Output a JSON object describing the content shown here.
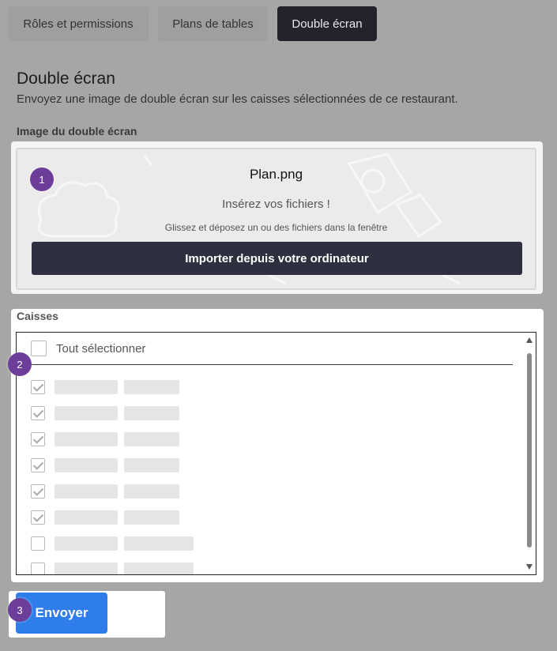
{
  "tabs": [
    {
      "label": "Rôles et permissions",
      "active": false
    },
    {
      "label": "Plans de tables",
      "active": false
    },
    {
      "label": "Double écran",
      "active": true
    }
  ],
  "page": {
    "title": "Double écran",
    "subtitle": "Envoyez une image de double écran sur les caisses sélectionnées de ce restaurant."
  },
  "upload": {
    "label": "Image du double écran",
    "file_name": "Plan.png",
    "drop_title": "Insérez vos fichiers !",
    "drop_hint": "Glissez et déposez un ou des fichiers dans la fenêtre",
    "import_button": "Importer depuis votre ordinateur"
  },
  "caisses": {
    "label": "Caisses",
    "select_all": "Tout sélectionner",
    "items": [
      {
        "checked": true
      },
      {
        "checked": true
      },
      {
        "checked": true
      },
      {
        "checked": true
      },
      {
        "checked": true
      },
      {
        "checked": true
      },
      {
        "checked": false
      },
      {
        "checked": false
      }
    ]
  },
  "submit": {
    "label": "Envoyer"
  },
  "badges": [
    "1",
    "2",
    "3"
  ],
  "colors": {
    "active_tab": "#23232e",
    "import_button": "#2e303f",
    "submit_button": "#2e7dea",
    "badge": "#6d3e99"
  }
}
